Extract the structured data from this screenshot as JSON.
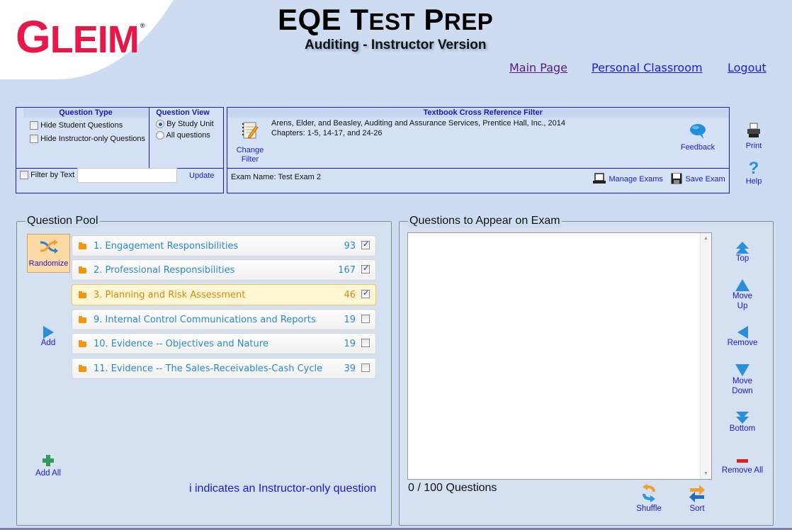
{
  "header": {
    "logo": {
      "first": "G",
      "rest": "LEIM",
      "mark": "®"
    },
    "title": {
      "w1_big": "EQE",
      "w2_big": "T",
      "w2_sm": "EST",
      "w3_big": "P",
      "w3_sm": "REP"
    },
    "subtitle": "Auditing - Instructor Version",
    "nav": [
      "Main Page",
      "Personal Classroom",
      "Logout"
    ]
  },
  "filters": {
    "question_type": {
      "title": "Question Type",
      "options": [
        {
          "label": "Hide Student Questions",
          "checked": false
        },
        {
          "label": "Hide Instructor-only Questions",
          "checked": false
        }
      ]
    },
    "question_view": {
      "title": "Question View",
      "options": [
        {
          "label": "By Study Unit",
          "selected": true
        },
        {
          "label": "All questions",
          "selected": false
        }
      ]
    },
    "text_filter": {
      "label": "Filter by Text",
      "checked": false,
      "value": "",
      "update_label": "Update"
    },
    "textbook": {
      "title": "Textbook Cross Reference Filter",
      "change_label_1": "Change",
      "change_label_2": "Filter",
      "reference": "Arens, Elder, and Beasley, Auditing and Assurance Services, Prentice Hall, Inc., 2014",
      "chapters": "Chapters: 1-5, 14-17, and 24-26",
      "feedback_label": "Feedback",
      "exam_name": "Exam Name: Test Exam 2",
      "manage_label": "Manage Exams",
      "save_label": "Save Exam"
    },
    "print_label": "Print",
    "help_label": "Help"
  },
  "pool": {
    "title": "Question Pool",
    "randomize_label": "Randomize",
    "add_label": "Add",
    "add_all_label": "Add All",
    "note": "i indicates an Instructor-only question",
    "units": [
      {
        "name": "1. Engagement Responsibilities",
        "count": "93",
        "checked": true,
        "selected": false
      },
      {
        "name": "2. Professional Responsibilities",
        "count": "167",
        "checked": true,
        "selected": false
      },
      {
        "name": "3. Planning and Risk Assessment",
        "count": "46",
        "checked": true,
        "selected": true
      },
      {
        "name": "9. Internal Control Communications and Reports",
        "count": "19",
        "checked": false,
        "selected": false
      },
      {
        "name": "10. Evidence -- Objectives and Nature",
        "count": "19",
        "checked": false,
        "selected": false
      },
      {
        "name": "11. Evidence -- The Sales-Receivables-Cash Cycle",
        "count": "39",
        "checked": false,
        "selected": false
      }
    ]
  },
  "exam": {
    "title": "Questions to Appear on Exam",
    "count_text": "0 / 100 Questions",
    "shuffle_label": "Shuffle",
    "sort_label": "Sort",
    "buttons": {
      "top": "Top",
      "move_up_1": "Move",
      "move_up_2": "Up",
      "remove": "Remove",
      "move_down_1": "Move",
      "move_down_2": "Down",
      "bottom": "Bottom",
      "remove_all": "Remove All"
    }
  },
  "colors": {
    "brand": "#e8174a",
    "link": "#1a1acc",
    "selected_unit": "#d48a10",
    "unit_text": "#2a8ac8"
  }
}
